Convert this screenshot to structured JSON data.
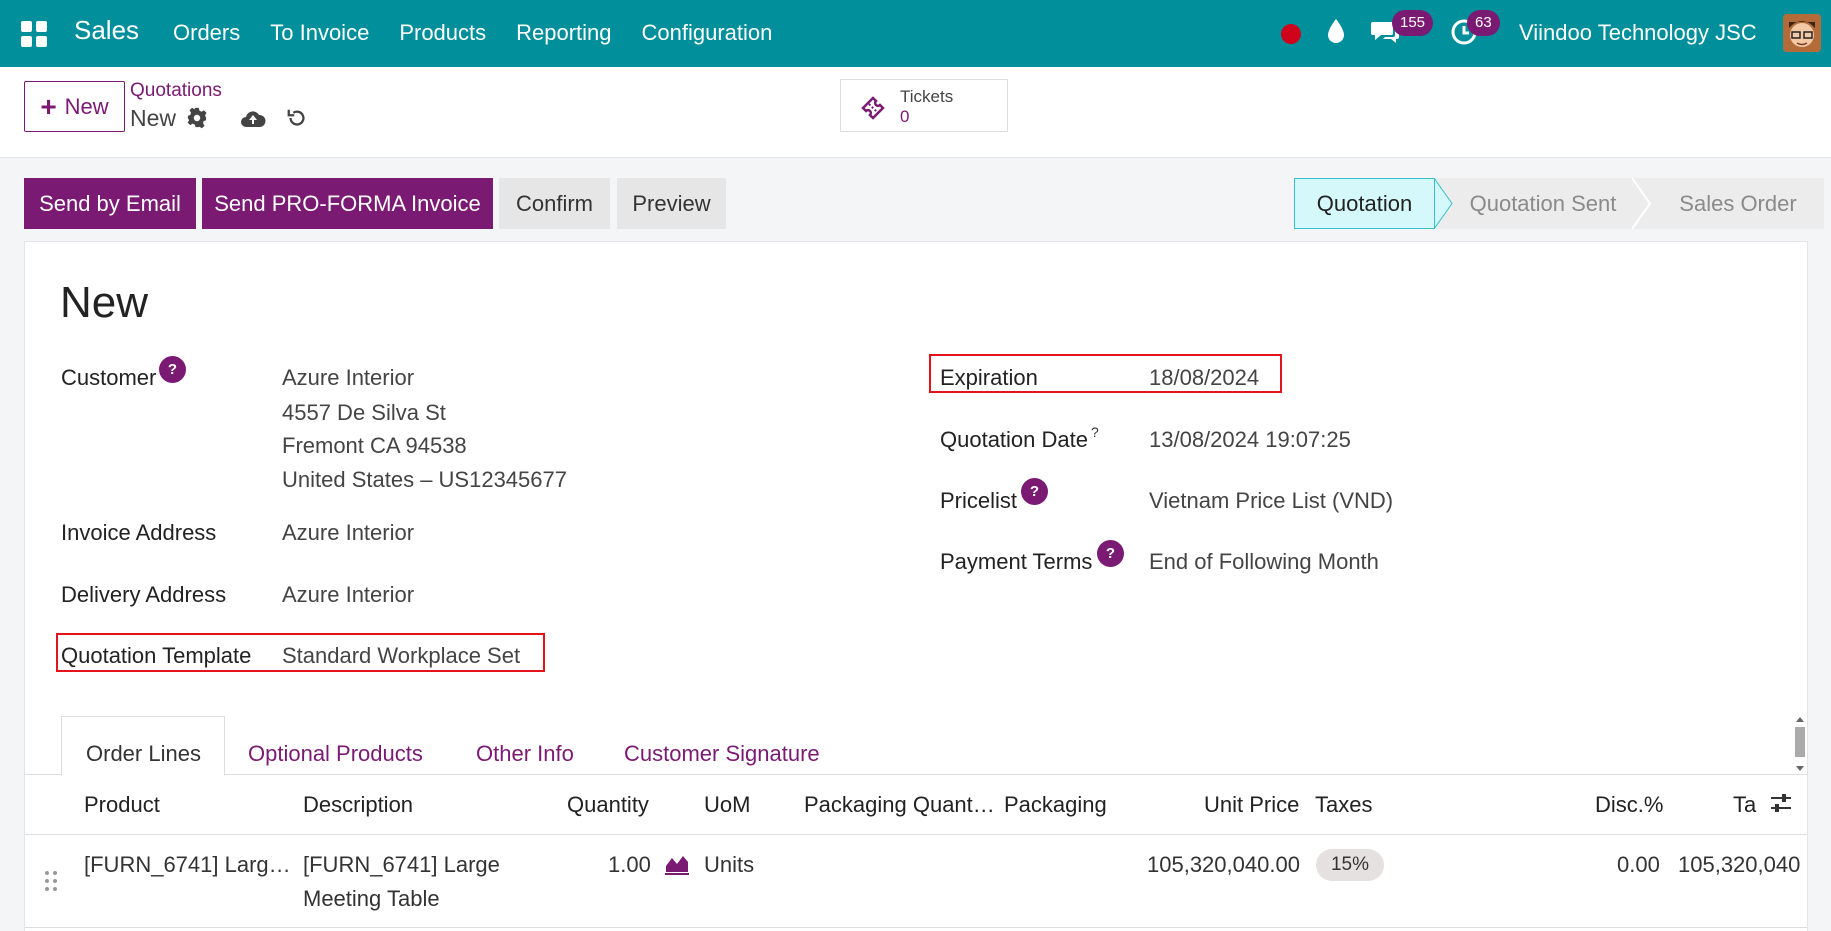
{
  "navbar": {
    "brand": "Sales",
    "menu": [
      "Orders",
      "To Invoice",
      "Products",
      "Reporting",
      "Configuration"
    ],
    "messages_count": "155",
    "activities_count": "63",
    "company": "Viindoo Technology JSC",
    "accent": "#008f9b"
  },
  "control": {
    "new_label": "New",
    "breadcrumb_parent": "Quotations",
    "breadcrumb_current": "New",
    "tickets_label": "Tickets",
    "tickets_count": "0"
  },
  "actions": {
    "send_email": "Send by Email",
    "send_proforma": "Send PRO-FORMA Invoice",
    "confirm": "Confirm",
    "preview": "Preview"
  },
  "status": {
    "steps": [
      "Quotation",
      "Quotation Sent",
      "Sales Order"
    ],
    "active": "Quotation"
  },
  "form": {
    "title": "New",
    "customer_label": "Customer",
    "customer_lines": [
      "Azure Interior",
      "4557 De Silva St",
      "Fremont CA 94538",
      "United States – US12345677"
    ],
    "invoice_address_label": "Invoice Address",
    "invoice_address": "Azure Interior",
    "delivery_address_label": "Delivery Address",
    "delivery_address": "Azure Interior",
    "template_label": "Quotation Template",
    "template": "Standard Workplace Set",
    "expiration_label": "Expiration",
    "expiration": "18/08/2024",
    "quotation_date_label": "Quotation Date",
    "quotation_date": "13/08/2024 19:07:25",
    "pricelist_label": "Pricelist",
    "pricelist": "Vietnam Price List (VND)",
    "payment_terms_label": "Payment Terms",
    "payment_terms": "End of Following Month",
    "help_glyph": "?"
  },
  "tabs": [
    "Order Lines",
    "Optional Products",
    "Other Info",
    "Customer Signature"
  ],
  "table": {
    "columns": [
      "Product",
      "Description",
      "Quantity",
      "UoM",
      "Packaging Quant…",
      "Packaging",
      "Unit Price",
      "Taxes",
      "Disc.%",
      "Ta"
    ],
    "rows": [
      {
        "product": "[FURN_6741] Larg…",
        "description_1": "[FURN_6741] Large",
        "description_2": "Meeting Table",
        "quantity": "1.00",
        "uom": "Units",
        "unit_price": "105,320,040.00",
        "taxes": "15%",
        "discount": "0.00",
        "total": "105,320,040"
      }
    ]
  }
}
